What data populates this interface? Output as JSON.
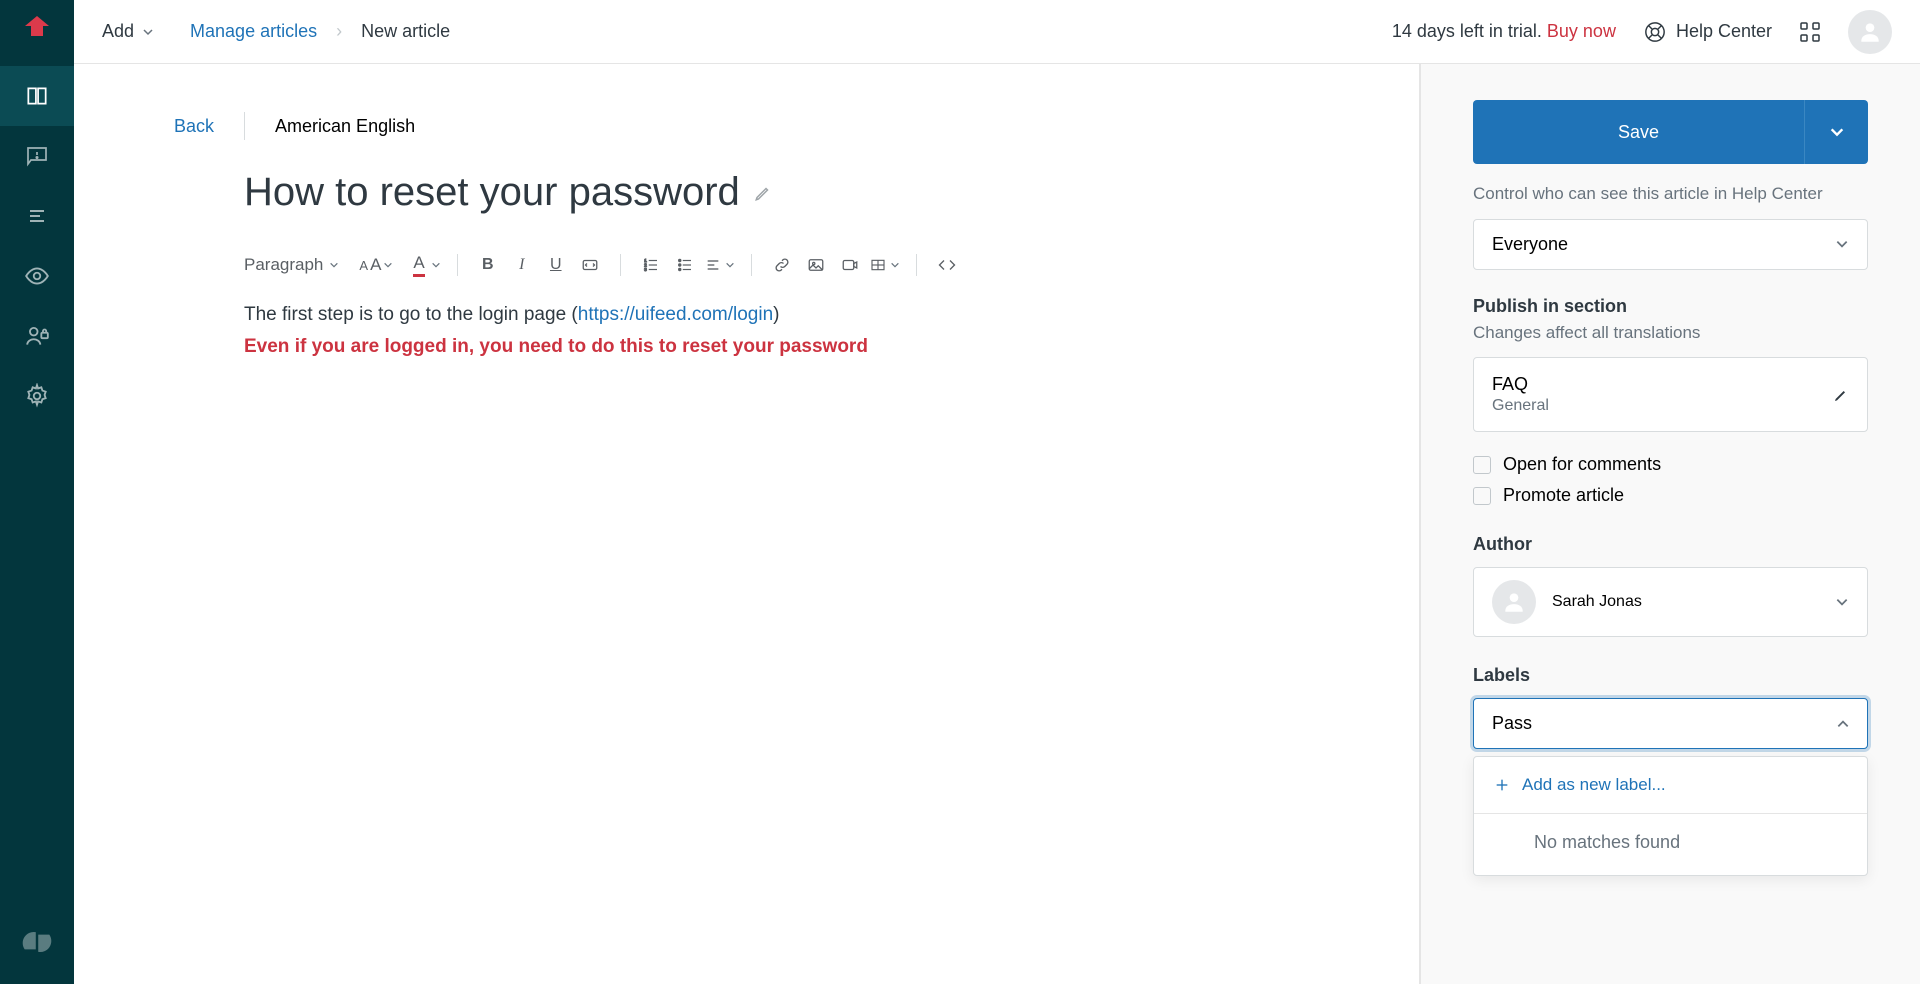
{
  "topbar": {
    "add_label": "Add",
    "breadcrumb": {
      "manage": "Manage articles",
      "current": "New article"
    },
    "trial": {
      "text": "14 days left in trial. ",
      "buy": "Buy now"
    },
    "help_center": "Help Center"
  },
  "editor": {
    "back": "Back",
    "locale": "American English",
    "title": "How to reset your password",
    "toolbar": {
      "paragraph": "Paragraph"
    },
    "body": {
      "first_line_pre": "The first step is to go to the login page (",
      "link": "https://uifeed.com/login",
      "first_line_post": ")",
      "warning": "Even if you are logged in, you need to do this to reset your password"
    }
  },
  "sidebar": {
    "save": "Save",
    "visibility_desc": "Control who can see this article in Help Center",
    "visibility_value": "Everyone",
    "publish_heading": "Publish in section",
    "publish_sub": "Changes affect all translations",
    "section": {
      "name": "FAQ",
      "sub": "General"
    },
    "open_comments": "Open for comments",
    "promote": "Promote article",
    "author_heading": "Author",
    "author_name": "Sarah Jonas",
    "labels_heading": "Labels",
    "labels_input": "Pass",
    "add_new_label": "Add as new label...",
    "no_matches": "No matches found"
  }
}
